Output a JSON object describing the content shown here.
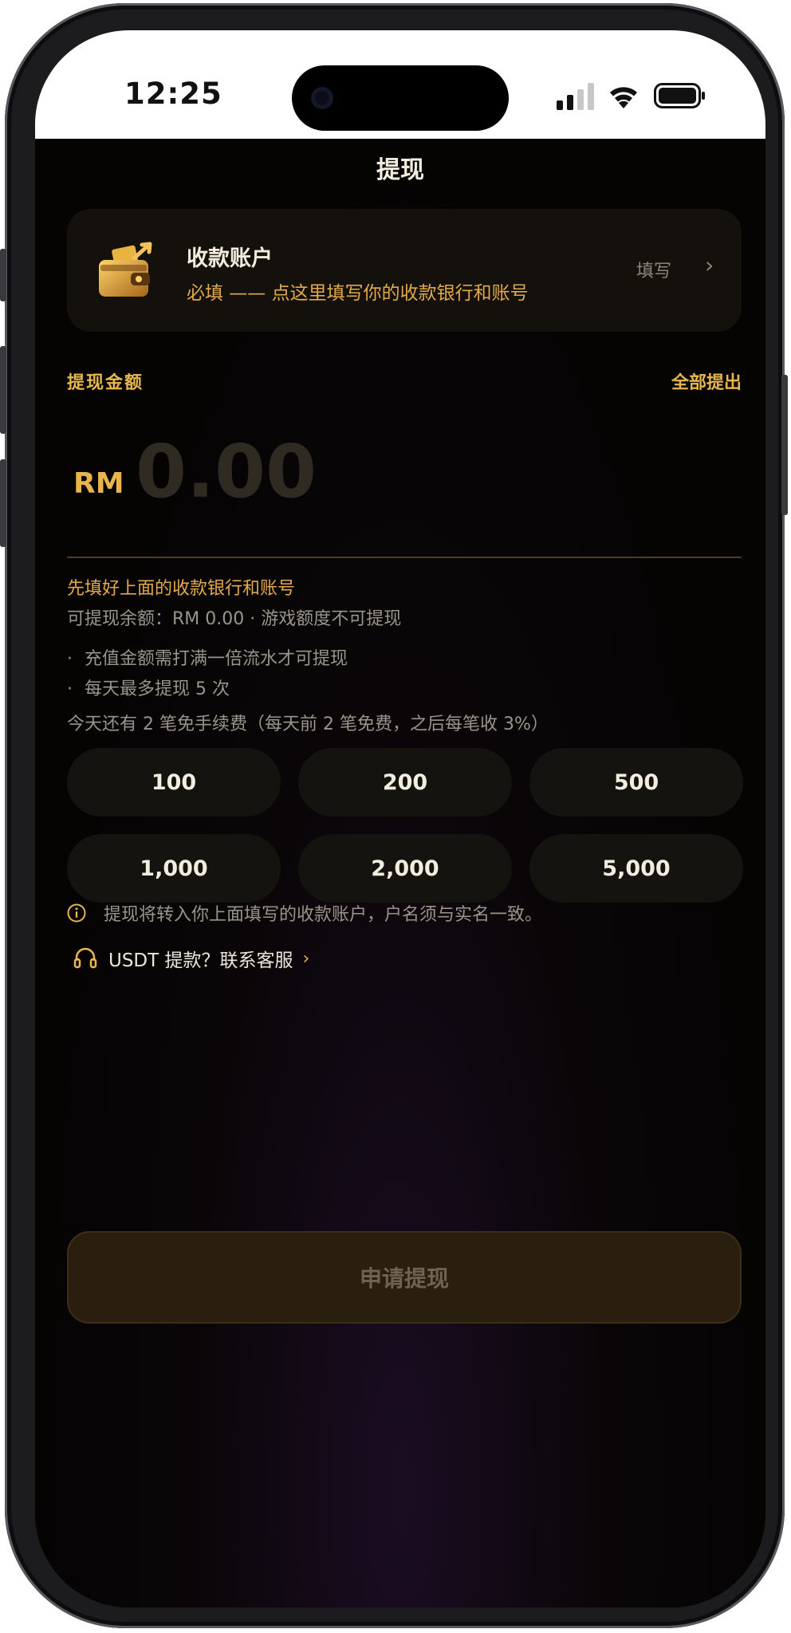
{
  "status_bar": {
    "time": "12:25",
    "icons": [
      "cellular-signal-icon",
      "wifi-icon",
      "battery-icon"
    ]
  },
  "header": {
    "title": "提现"
  },
  "account_card": {
    "icon": "wallet-icon",
    "title": "收款账户",
    "subtitle": "必填 —— 点这里填写你的收款银行和账号",
    "action_label": "填写",
    "chevron": "›"
  },
  "amount": {
    "label": "提现金额",
    "withdraw_all": "全部提出",
    "currency": "RM",
    "placeholder": "0.00"
  },
  "hints": {
    "warning": "先填好上面的收款银行和账号",
    "balance": "可提现余额：RM 0.00 · 游戏额度不可提现",
    "rules": [
      "充值金额需打满一倍流水才可提现",
      "每天最多提现 5 次"
    ],
    "bullet": "·",
    "fee": "今天还有 2 笔免手续费（每天前 2 笔免费，之后每笔收 3%）"
  },
  "quick_amounts": [
    "100",
    "200",
    "500",
    "1,000",
    "2,000",
    "5,000"
  ],
  "notice": {
    "icon": "info-icon",
    "text": "提现将转入你上面填写的收款账户，户名须与实名一致。"
  },
  "support": {
    "icon": "headset-icon",
    "text": "USDT 提款？联系客服",
    "chevron": "›"
  },
  "submit": {
    "label": "申请提现"
  },
  "colors": {
    "accent": "#e7b64e",
    "background": "#050403",
    "card": "#14110d",
    "text": "#f3ede0",
    "muted": "#9b948a"
  }
}
